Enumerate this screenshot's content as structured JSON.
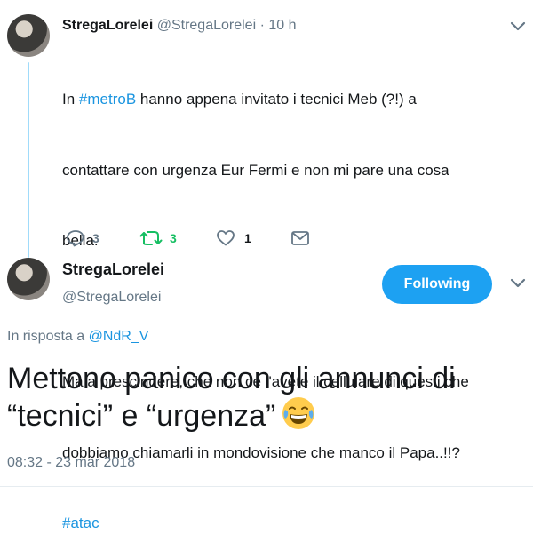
{
  "parent": {
    "name": "StregaLorelei",
    "handle": "@StregaLorelei",
    "separator": "·",
    "time": "10 h",
    "line1_pre": "In ",
    "hashtag1": "#metroB",
    "line1_post": " hanno appena invitato i tecnici Meb (?!) a",
    "line2": "contattare con urgenza Eur Fermi e non mi pare una cosa",
    "line3": "bella.",
    "line4": "Ma a prescindere, che non ce l'avete il cellulare di questi che",
    "line5": "dobbiamo chiamarli in mondovisione che manco il Papa..!!?",
    "hashtag2": "#atac",
    "reply_count": "3",
    "retweet_count": "3",
    "like_count": "1",
    "colors": {
      "link": "#1b95e0",
      "retweet": "#17bf63",
      "muted": "#657786"
    }
  },
  "tweet": {
    "name": "StregaLorelei",
    "handle": "@StregaLorelei",
    "follow_label": "Following",
    "reply_prefix": "In risposta a ",
    "reply_to": "@NdR_V",
    "text_line1": "Mettono panico con gli annunci di",
    "text_line2": "“tecnici” e “urgenza”",
    "emoji": "face-with-tears-of-joy",
    "timestamp": "08:32 - 23 mar 2018",
    "colors": {
      "follow_bg": "#1da1f2",
      "thread_line": "#a0dbfa"
    }
  }
}
